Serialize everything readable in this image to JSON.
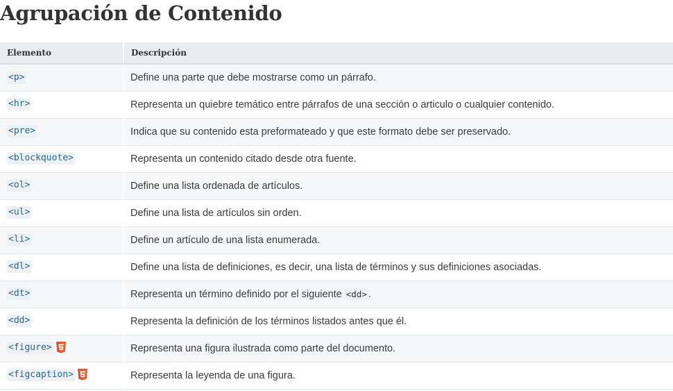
{
  "page": {
    "title": "Agrupación de Contenido"
  },
  "table": {
    "headers": {
      "element": "Elemento",
      "description": "Descripción"
    },
    "rows": [
      {
        "element": "<p>",
        "html5": false,
        "description": "Define una parte que debe mostrarse como un párrafo."
      },
      {
        "element": "<hr>",
        "html5": false,
        "description": "Representa un quiebre temático entre párrafos de una sección o articulo o cualquier contenido."
      },
      {
        "element": "<pre>",
        "html5": false,
        "description": "Indica que su contenido esta preformateado y que este formato debe ser preservado."
      },
      {
        "element": "<blockquote>",
        "html5": false,
        "description": "Representa un contenido citado desde otra fuente."
      },
      {
        "element": "<ol>",
        "html5": false,
        "description": "Define una lista ordenada de artículos."
      },
      {
        "element": "<ul>",
        "html5": false,
        "description": "Define una lista de artículos sin orden."
      },
      {
        "element": "<li>",
        "html5": false,
        "description": "Define un artículo de una lista enumerada."
      },
      {
        "element": "<dl>",
        "html5": false,
        "description": "Define una lista de definiciones, es decir, una lista de términos y sus definiciones asociadas."
      },
      {
        "element": "<dt>",
        "html5": false,
        "description_before": "Representa un término definido por el siguiente ",
        "description_code": "<dd>",
        "description_after": "."
      },
      {
        "element": "<dd>",
        "html5": false,
        "description": "Representa la definición de los términos listados antes que él."
      },
      {
        "element": "<figure>",
        "html5": true,
        "description": "Representa una figura ilustrada como parte del documento."
      },
      {
        "element": "<figcaption>",
        "html5": true,
        "description": "Representa la leyenda de una figura."
      }
    ]
  },
  "colors": {
    "header_bg": "#e9edf0",
    "row_alt_bg": "#f6f7f8",
    "code_text": "#1e6b93",
    "html5_badge": "#e44d26"
  },
  "icons": {
    "html5_badge": "html5-icon"
  }
}
